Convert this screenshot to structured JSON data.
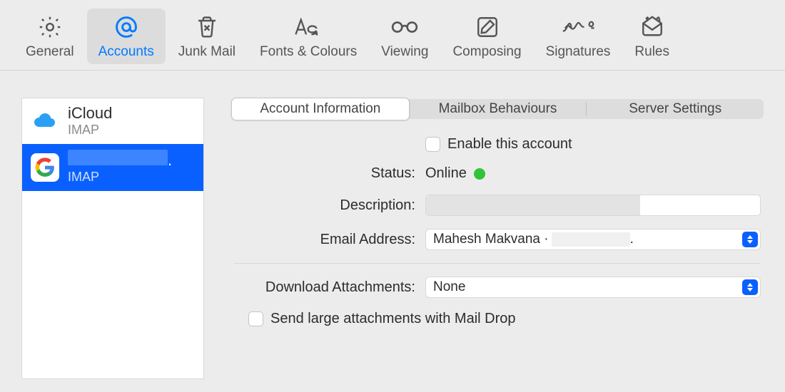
{
  "toolbar": {
    "general": "General",
    "accounts": "Accounts",
    "junk": "Junk Mail",
    "fonts": "Fonts & Colours",
    "viewing": "Viewing",
    "composing": "Composing",
    "signatures": "Signatures",
    "rules": "Rules",
    "selected": "accounts"
  },
  "sidebar": {
    "accounts": [
      {
        "name": "iCloud",
        "type": "IMAP",
        "provider": "icloud"
      },
      {
        "name": "",
        "type": "IMAP",
        "provider": "google",
        "redacted": true,
        "selected": true
      }
    ]
  },
  "tabs": {
    "info": "Account Information",
    "behaviours": "Mailbox Behaviours",
    "server": "Server Settings",
    "active": "info"
  },
  "form": {
    "enable_label": "Enable this account",
    "enable_checked": false,
    "status_label": "Status:",
    "status_value": "Online",
    "desc_label": "Description:",
    "desc_value": "",
    "email_label": "Email Address:",
    "email_value": "Mahesh Makvana ·",
    "download_label": "Download Attachments:",
    "download_value": "None",
    "maildrop_label": "Send large attachments with Mail Drop",
    "maildrop_checked": false
  }
}
